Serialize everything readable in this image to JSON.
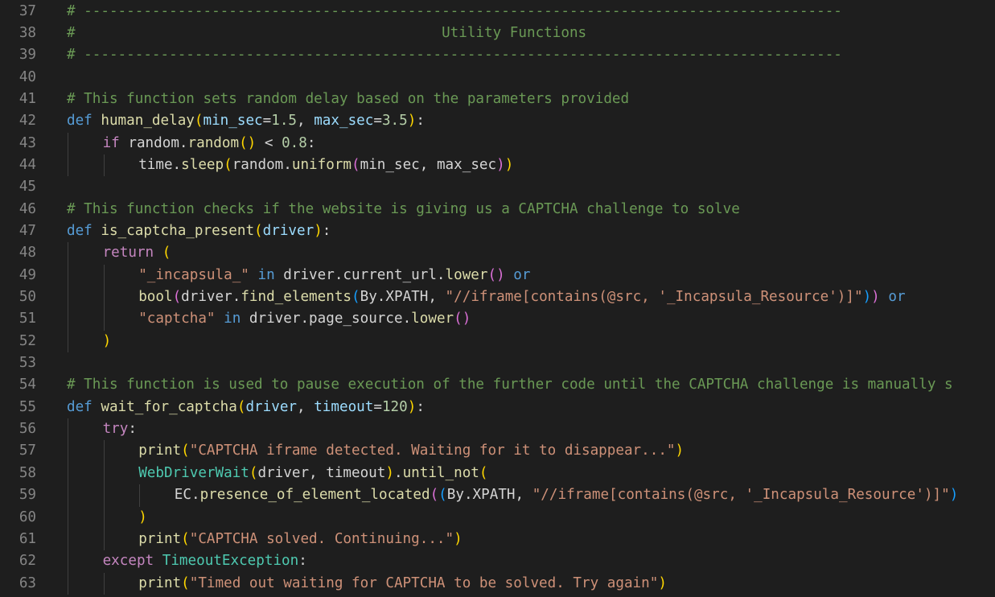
{
  "editor": {
    "language": "python",
    "colors": {
      "background": "#1e1e1e",
      "line_number": "#858585",
      "comment": "#6a9955",
      "keyword": "#569cd6",
      "control": "#c586c0",
      "function": "#dcdcaa",
      "parameter": "#9cdcfe",
      "number": "#b5cea8",
      "string": "#ce9178",
      "class": "#4ec9b0",
      "bracket_1": "#ffd700",
      "bracket_2": "#da70d6",
      "bracket_3": "#179fff"
    },
    "lines": [
      {
        "n": "37",
        "indent": 0,
        "tokens": [
          [
            "comment",
            "# -----------------------------------------------------------------------------------------"
          ]
        ]
      },
      {
        "n": "38",
        "indent": 0,
        "tokens": [
          [
            "comment",
            "#                                           Utility Functions"
          ]
        ]
      },
      {
        "n": "39",
        "indent": 0,
        "tokens": [
          [
            "comment",
            "# -----------------------------------------------------------------------------------------"
          ]
        ]
      },
      {
        "n": "40",
        "indent": 0,
        "tokens": []
      },
      {
        "n": "41",
        "indent": 0,
        "tokens": [
          [
            "comment",
            "# This function sets random delay based on the parameters provided"
          ]
        ]
      },
      {
        "n": "42",
        "indent": 0,
        "tokens": [
          [
            "kw",
            "def"
          ],
          [
            "plain",
            " "
          ],
          [
            "fn",
            "human_delay"
          ],
          [
            "b1",
            "("
          ],
          [
            "param",
            "min_sec"
          ],
          [
            "plain",
            "="
          ],
          [
            "num",
            "1.5"
          ],
          [
            "plain",
            ", "
          ],
          [
            "param",
            "max_sec"
          ],
          [
            "plain",
            "="
          ],
          [
            "num",
            "3.5"
          ],
          [
            "b1",
            ")"
          ],
          [
            "plain",
            ":"
          ]
        ]
      },
      {
        "n": "43",
        "indent": 1,
        "tokens": [
          [
            "ctrl",
            "if"
          ],
          [
            "plain",
            " random."
          ],
          [
            "fn",
            "random"
          ],
          [
            "b1",
            "()"
          ],
          [
            "plain",
            " < "
          ],
          [
            "num",
            "0.8"
          ],
          [
            "plain",
            ":"
          ]
        ]
      },
      {
        "n": "44",
        "indent": 2,
        "tokens": [
          [
            "plain",
            "time."
          ],
          [
            "fn",
            "sleep"
          ],
          [
            "b1",
            "("
          ],
          [
            "plain",
            "random."
          ],
          [
            "fn",
            "uniform"
          ],
          [
            "b2",
            "("
          ],
          [
            "plain",
            "min_sec, max_sec"
          ],
          [
            "b2",
            ")"
          ],
          [
            "b1",
            ")"
          ]
        ]
      },
      {
        "n": "45",
        "indent": 0,
        "tokens": []
      },
      {
        "n": "46",
        "indent": 0,
        "tokens": [
          [
            "comment",
            "# This function checks if the website is giving us a CAPTCHA challenge to solve"
          ]
        ]
      },
      {
        "n": "47",
        "indent": 0,
        "tokens": [
          [
            "kw",
            "def"
          ],
          [
            "plain",
            " "
          ],
          [
            "fn",
            "is_captcha_present"
          ],
          [
            "b1",
            "("
          ],
          [
            "param",
            "driver"
          ],
          [
            "b1",
            ")"
          ],
          [
            "plain",
            ":"
          ]
        ]
      },
      {
        "n": "48",
        "indent": 1,
        "tokens": [
          [
            "ctrl",
            "return"
          ],
          [
            "plain",
            " "
          ],
          [
            "b1",
            "("
          ]
        ]
      },
      {
        "n": "49",
        "indent": 2,
        "tokens": [
          [
            "str",
            "\"_incapsula_\""
          ],
          [
            "plain",
            " "
          ],
          [
            "kw",
            "in"
          ],
          [
            "plain",
            " driver.current_url."
          ],
          [
            "fn",
            "lower"
          ],
          [
            "b2",
            "()"
          ],
          [
            "plain",
            " "
          ],
          [
            "kw",
            "or"
          ]
        ]
      },
      {
        "n": "50",
        "indent": 2,
        "tokens": [
          [
            "fn",
            "bool"
          ],
          [
            "b2",
            "("
          ],
          [
            "plain",
            "driver."
          ],
          [
            "fn",
            "find_elements"
          ],
          [
            "b3",
            "("
          ],
          [
            "plain",
            "By.XPATH, "
          ],
          [
            "str",
            "\"//iframe[contains(@src, '_Incapsula_Resource')]\""
          ],
          [
            "b3",
            ")"
          ],
          [
            "b2",
            ")"
          ],
          [
            "plain",
            " "
          ],
          [
            "kw",
            "or"
          ]
        ]
      },
      {
        "n": "51",
        "indent": 2,
        "tokens": [
          [
            "str",
            "\"captcha\""
          ],
          [
            "plain",
            " "
          ],
          [
            "kw",
            "in"
          ],
          [
            "plain",
            " driver.page_source."
          ],
          [
            "fn",
            "lower"
          ],
          [
            "b2",
            "()"
          ]
        ]
      },
      {
        "n": "52",
        "indent": 1,
        "tokens": [
          [
            "b1",
            ")"
          ]
        ]
      },
      {
        "n": "53",
        "indent": 0,
        "tokens": []
      },
      {
        "n": "54",
        "indent": 0,
        "tokens": [
          [
            "comment",
            "# This function is used to pause execution of the further code until the CAPTCHA challenge is manually s"
          ]
        ]
      },
      {
        "n": "55",
        "indent": 0,
        "tokens": [
          [
            "kw",
            "def"
          ],
          [
            "plain",
            " "
          ],
          [
            "fn",
            "wait_for_captcha"
          ],
          [
            "b1",
            "("
          ],
          [
            "param",
            "driver"
          ],
          [
            "plain",
            ", "
          ],
          [
            "param",
            "timeout"
          ],
          [
            "plain",
            "="
          ],
          [
            "num",
            "120"
          ],
          [
            "b1",
            ")"
          ],
          [
            "plain",
            ":"
          ]
        ]
      },
      {
        "n": "56",
        "indent": 1,
        "tokens": [
          [
            "ctrl",
            "try"
          ],
          [
            "plain",
            ":"
          ]
        ]
      },
      {
        "n": "57",
        "indent": 2,
        "tokens": [
          [
            "fn",
            "print"
          ],
          [
            "b1",
            "("
          ],
          [
            "str",
            "\"CAPTCHA iframe detected. Waiting for it to disappear...\""
          ],
          [
            "b1",
            ")"
          ]
        ]
      },
      {
        "n": "58",
        "indent": 2,
        "tokens": [
          [
            "cls",
            "WebDriverWait"
          ],
          [
            "b1",
            "("
          ],
          [
            "plain",
            "driver, timeout"
          ],
          [
            "b1",
            ")"
          ],
          [
            "plain",
            "."
          ],
          [
            "fn",
            "until_not"
          ],
          [
            "b1",
            "("
          ]
        ]
      },
      {
        "n": "59",
        "indent": 3,
        "tokens": [
          [
            "plain",
            "EC."
          ],
          [
            "fn",
            "presence_of_element_located"
          ],
          [
            "b2",
            "("
          ],
          [
            "b3",
            "("
          ],
          [
            "plain",
            "By.XPATH, "
          ],
          [
            "str",
            "\"//iframe[contains(@src, '_Incapsula_Resource')]\""
          ],
          [
            "b3",
            ")"
          ]
        ]
      },
      {
        "n": "60",
        "indent": 2,
        "tokens": [
          [
            "b1",
            ")"
          ]
        ]
      },
      {
        "n": "61",
        "indent": 2,
        "tokens": [
          [
            "fn",
            "print"
          ],
          [
            "b1",
            "("
          ],
          [
            "str",
            "\"CAPTCHA solved. Continuing...\""
          ],
          [
            "b1",
            ")"
          ]
        ]
      },
      {
        "n": "62",
        "indent": 1,
        "tokens": [
          [
            "ctrl",
            "except"
          ],
          [
            "plain",
            " "
          ],
          [
            "cls",
            "TimeoutException"
          ],
          [
            "plain",
            ":"
          ]
        ]
      },
      {
        "n": "63",
        "indent": 2,
        "tokens": [
          [
            "fn",
            "print"
          ],
          [
            "b1",
            "("
          ],
          [
            "str",
            "\"Timed out waiting for CAPTCHA to be solved. Try again\""
          ],
          [
            "b1",
            ")"
          ]
        ]
      }
    ]
  }
}
